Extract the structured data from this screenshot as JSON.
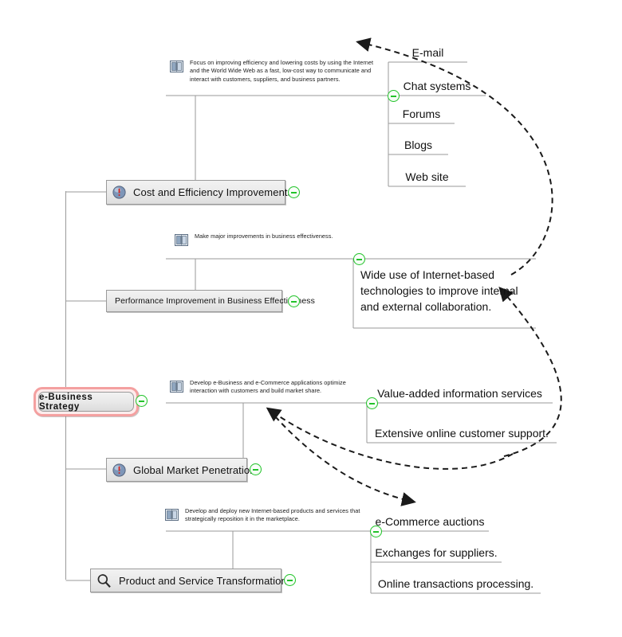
{
  "diagram": {
    "title": "e-Business Strategy",
    "type": "mind-map",
    "accent_green": "#22c32a",
    "root_border": "#f4a0a0",
    "node_fill": "#ebebeb",
    "node_border": "#9a9a9a"
  },
  "root": {
    "label": "e-Business Strategy",
    "toggle_icon": "collapse-minus-icon"
  },
  "branches": [
    {
      "id": "cost-efficiency",
      "label": "Cost and Efficiency Improvements",
      "icon": "alert-circle-icon",
      "toggle_icon": "collapse-minus-icon",
      "note": {
        "icon": "book-icon",
        "text": "Focus on improving efficiency and lowering costs by using the Internet and the World Wide Web as a fast, low-cost way to communicate and interact with customers, suppliers, and business partners."
      },
      "leaves": [
        "E-mail",
        "Chat systems",
        "Forums",
        "Blogs",
        "Web site"
      ]
    },
    {
      "id": "performance-improvement",
      "label": "Performance Improvement in Business Effectiveness",
      "icon": "none",
      "toggle_icon": "collapse-minus-icon",
      "note": {
        "icon": "book-icon",
        "text": "Make major improvements in business effectiveness."
      },
      "leaves": [
        "Wide use of Internet-based technologies to improve internal and external collaboration."
      ]
    },
    {
      "id": "global-market-penetration",
      "label": "Global Market Penetration",
      "icon": "alert-circle-icon",
      "toggle_icon": "collapse-minus-icon",
      "note": {
        "icon": "book-icon",
        "text": "Develop e-Business and e-Commerce applications optimize interaction with customers and build market share."
      },
      "leaves": [
        "Value-added information services",
        "Extensive online customer support."
      ]
    },
    {
      "id": "product-service-transformation",
      "label": "Product and Service Transformation",
      "icon": "magnifier-icon",
      "toggle_icon": "collapse-minus-icon",
      "note": {
        "icon": "book-icon",
        "text": "Develop and deploy new Internet-based products and services that strategically reposition it in the marketplace."
      },
      "leaves": [
        "e-Commerce auctions",
        "Exchanges for suppliers.",
        "Online transactions processing."
      ]
    }
  ]
}
